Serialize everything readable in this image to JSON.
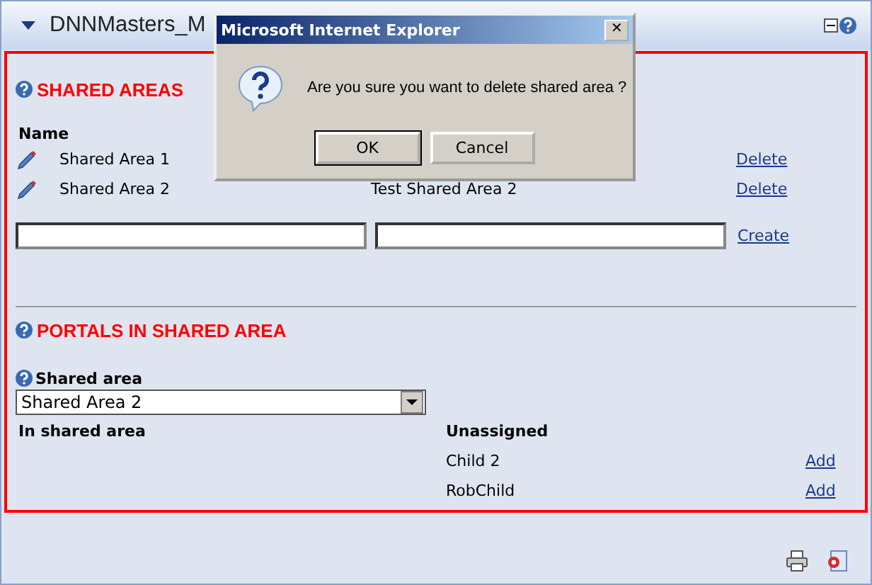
{
  "module": {
    "title": "DNNMasters_M"
  },
  "shared_areas": {
    "heading": "SHARED AREAS",
    "column": "Name",
    "rows": [
      {
        "name": "Shared Area 1",
        "action": "Delete"
      },
      {
        "name": "Shared Area 2",
        "description": "Test Shared Area 2",
        "action": "Delete"
      }
    ],
    "create": "Create"
  },
  "portals": {
    "heading": "PORTALS IN SHARED AREA",
    "field_label": "Shared area",
    "select_value": "Shared Area 2",
    "in_area_heading": "In shared area",
    "unassigned_heading": "Unassigned",
    "unassigned": [
      {
        "name": "Child 2",
        "action": "Add"
      },
      {
        "name": "RobChild",
        "action": "Add"
      }
    ]
  },
  "dialog": {
    "title": "Microsoft Internet Explorer",
    "close": "✕",
    "message": "Are you sure you want to delete shared area ?",
    "buttons": [
      "OK",
      "Cancel"
    ]
  }
}
